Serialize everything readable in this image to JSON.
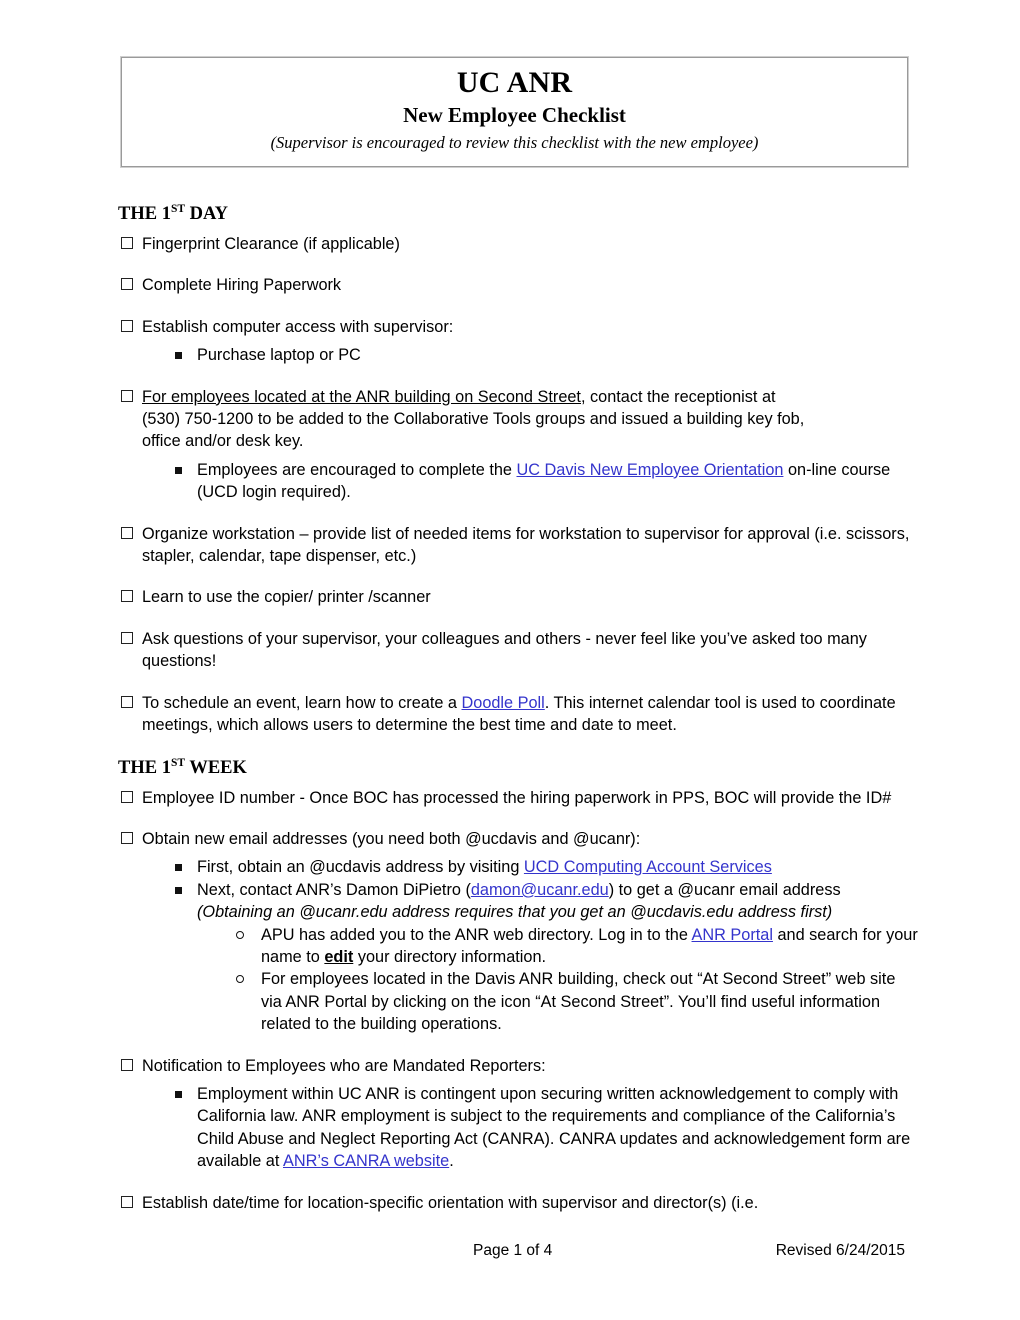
{
  "header": {
    "org_title": "UC ANR",
    "doc_title": "New Employee Checklist",
    "subtitle": "(Supervisor is encouraged to review this checklist with the new employee)"
  },
  "sections": {
    "first_day": {
      "heading_pre": "THE 1",
      "heading_sup": "ST",
      "heading_post": " DAY",
      "items": {
        "fingerprint": "Fingerprint Clearance (if applicable)",
        "hiring_paperwork": "Complete Hiring Paperwork",
        "computer_access": "Establish computer access with supervisor:",
        "computer_access_sub1": "Purchase laptop or PC",
        "second_street_underlined": "For employees located at the ANR building on Second Street,",
        "second_street_rest": " contact the receptionist at",
        "second_street_line2": "(530) 750-1200 to be added to the Collaborative Tools groups and issued a building key fob,",
        "second_street_line3": "office and/or desk key.",
        "orientation_pre": "Employees are encouraged to complete the ",
        "orientation_link": "UC Davis New Employee Orientation",
        "orientation_post": " on-line course (UCD login required).",
        "organize_workstation": "Organize workstation – provide list of needed items for workstation to supervisor for approval (i.e. scissors, stapler, calendar, tape dispenser, etc.)",
        "copier": "Learn to use the copier/ printer /scanner",
        "ask_questions": "Ask questions of your supervisor, your colleagues and others - never feel like you’ve asked too many questions!",
        "doodle_pre": "To schedule an event, learn how to create a ",
        "doodle_link": "Doodle Poll",
        "doodle_post": ". This internet calendar tool is used to coordinate meetings, which allows users to determine the best time and date to meet."
      }
    },
    "first_week": {
      "heading_pre": "THE 1",
      "heading_sup": "ST",
      "heading_post": " WEEK",
      "items": {
        "employee_id": "Employee ID number - Once BOC has processed the hiring paperwork in PPS, BOC will provide the ID#",
        "email_addresses": "Obtain new email addresses (you need both @ucdavis and @ucanr):",
        "email_sub1_pre": "First, obtain an @ucdavis address by visiting ",
        "email_sub1_link": "UCD Computing Account Services",
        "email_sub2_pre": "Next, contact ANR’s Damon DiPietro (",
        "email_sub2_link": "damon@ucanr.edu",
        "email_sub2_post": ") to get a @ucanr email address",
        "email_sub2_italic": "(Obtaining an @ucanr.edu address requires that you get an @ucdavis.edu address first)",
        "apu_pre": "APU has added you to the ANR web directory. Log in to the ",
        "apu_link": "ANR Portal",
        "apu_mid": " and search for your name to ",
        "apu_bold": "edit",
        "apu_post": " your directory information.",
        "second_street_site": "For employees located in the Davis ANR building, check out “At Second Street” web site via ANR Portal by clicking on the icon “At Second Street”. You’ll find useful information related to the building operations.",
        "mandated_reporters": "Notification to Employees who are Mandated Reporters:",
        "mandated_sub_pre": "Employment within UC ANR is contingent upon securing written acknowledgement to comply with California law. ANR employment is subject to the requirements and compliance of the California’s Child Abuse and Neglect Reporting Act (CANRA).  CANRA updates and acknowledgement form are available at ",
        "mandated_sub_link": "ANR’s CANRA website",
        "mandated_sub_post": ".",
        "orientation_datetime": "Establish date/time for location-specific orientation with supervisor and director(s) (i.e."
      }
    }
  },
  "footer": {
    "page_number": "Page 1 of 4",
    "revised": "Revised 6/24/2015"
  },
  "colors": {
    "link": "#3434CC",
    "text": "#000000",
    "box_border": "#9A9A9A"
  }
}
